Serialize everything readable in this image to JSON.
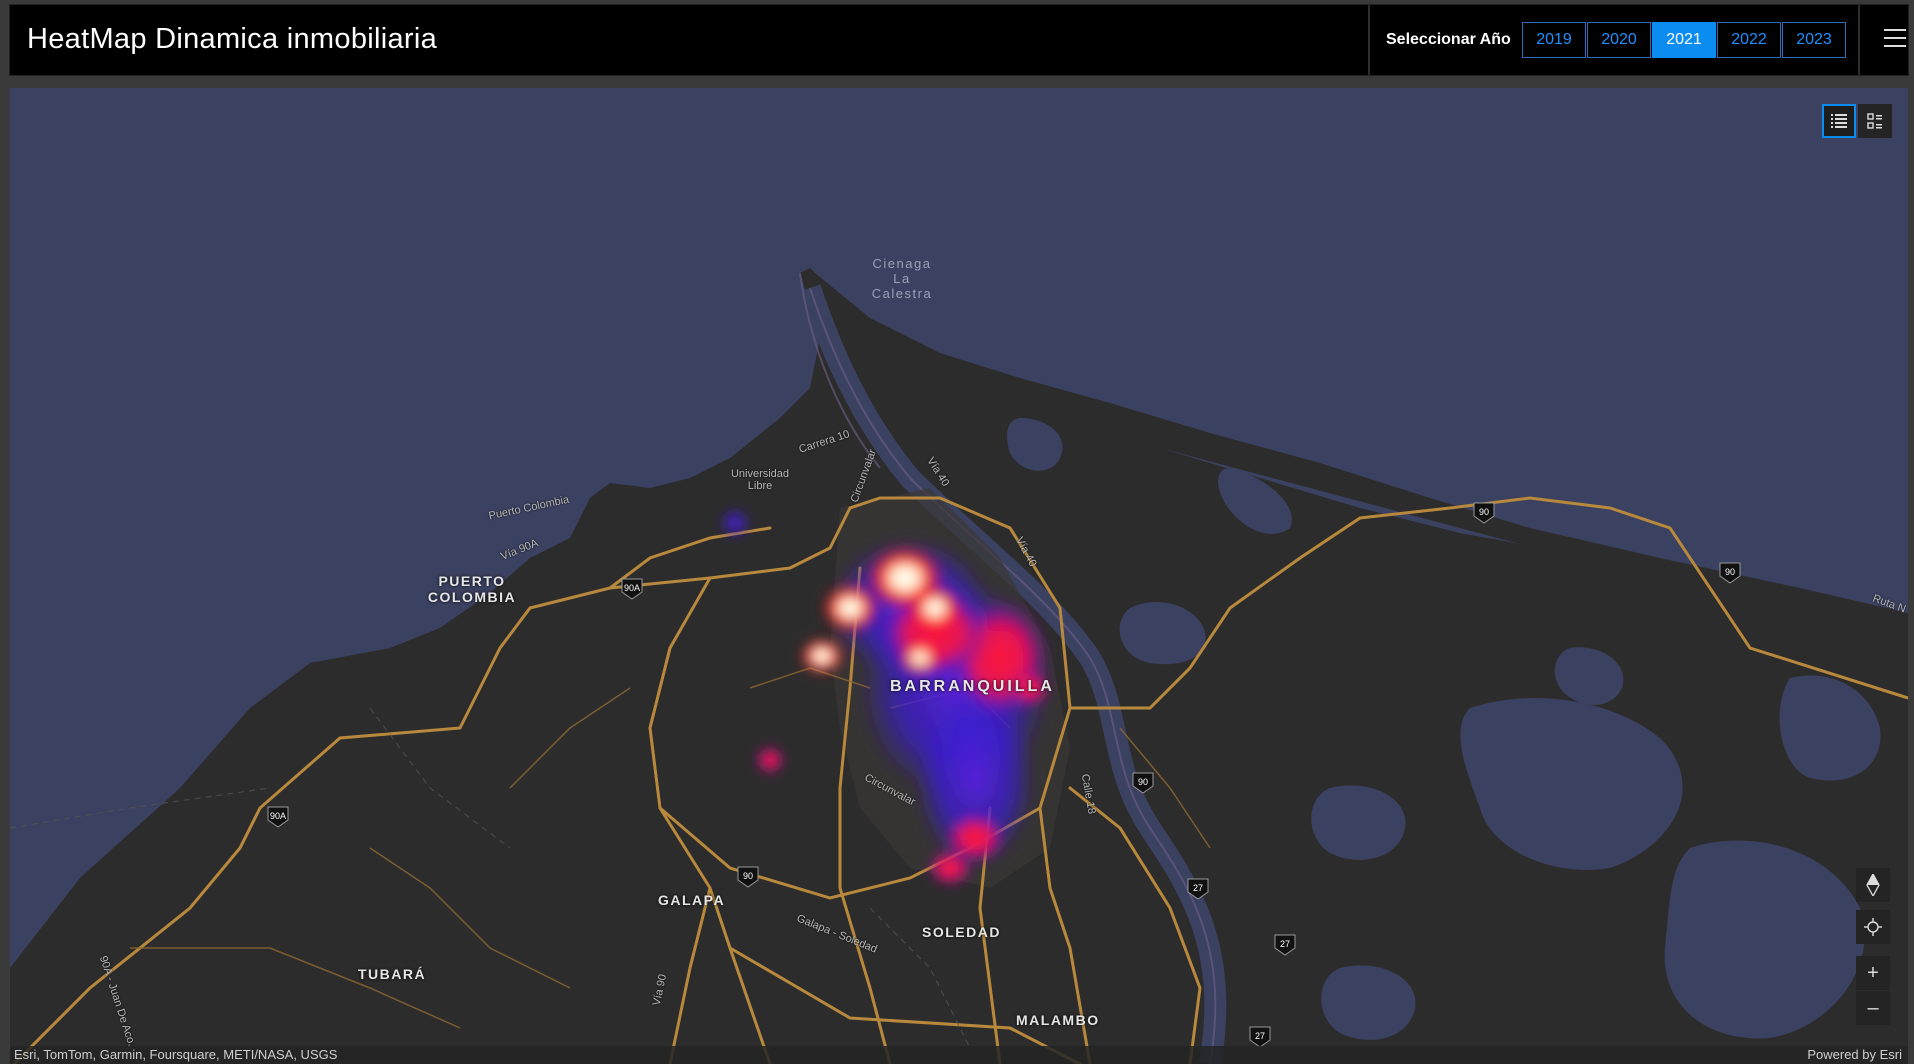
{
  "header": {
    "title": "HeatMap Dinamica inmobiliaria",
    "year_label": "Seleccionar Año",
    "years": [
      "2019",
      "2020",
      "2021",
      "2022",
      "2023"
    ],
    "selected_year": "2021"
  },
  "map": {
    "places": {
      "barranquilla": "BARRANQUILLA",
      "puerto_colombia_1": "PUERTO",
      "puerto_colombia_2": "COLOMBIA",
      "galapa": "GALAPA",
      "soledad": "SOLEDAD",
      "tubara": "TUBARÁ",
      "malambo": "MALAMBO"
    },
    "water": {
      "cienaga_1": "Cienaga",
      "cienaga_2": "La",
      "cienaga_3": "Calestra"
    },
    "roads": {
      "carrera10": "Carrera 10",
      "via40_a": "Vía 40",
      "via40_b": "Vía 40",
      "via90a": "Vía 90A",
      "puerto_colombia_road": "Puerto Colombia",
      "circunvalar_a": "Circunvalar",
      "circunvalar_b": "Circunvalar",
      "calle18": "Calle 18",
      "galapa_soledad": "Galapa - Soledad",
      "via90": "Vía 90",
      "juan_de_acosta": "90A - Juan De Aco...",
      "ruta": "Ruta N",
      "universidad_1": "Universidad",
      "universidad_2": "Libre"
    },
    "shields": [
      "90A",
      "90A",
      "90",
      "90",
      "90",
      "90",
      "27",
      "27",
      "27"
    ],
    "attribution": "Esri, TomTom, Garmin, Foursquare, METI/NASA, USGS",
    "powered_by": "Powered by Esri",
    "colors": {
      "water": "#3b4160",
      "land": "#2d2c2c",
      "roads": "#b8893c",
      "heat_low": "#3a1bd6",
      "heat_mid": "#ff1030",
      "heat_high": "#ffffff",
      "accent": "#0a8cf0"
    }
  }
}
